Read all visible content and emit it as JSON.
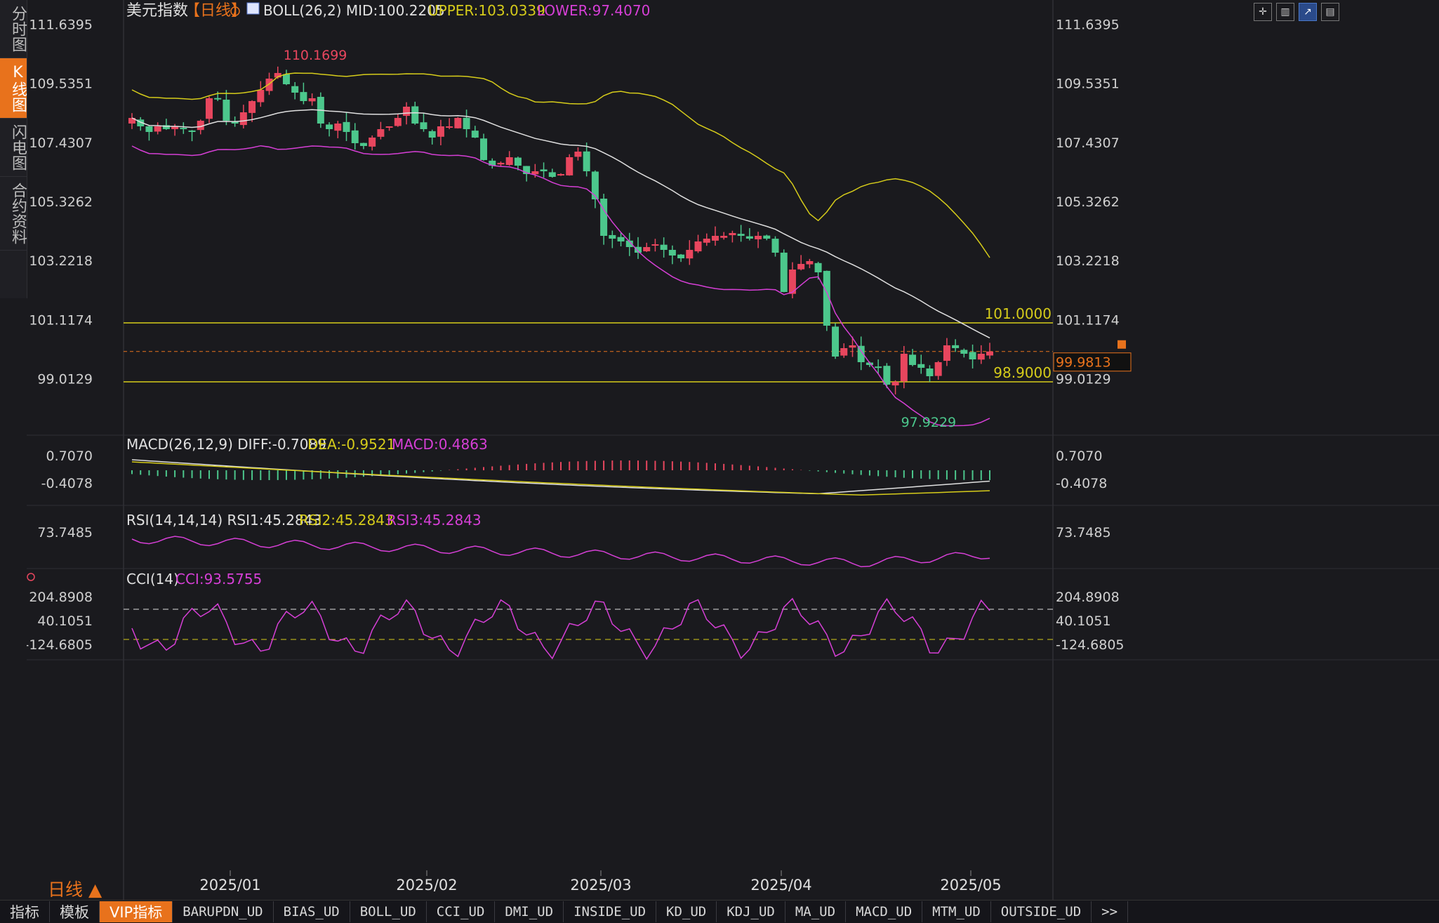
{
  "left_tabs": [
    {
      "label": "分时图",
      "active": false
    },
    {
      "label": "K线图",
      "active": true
    },
    {
      "label": "闪电图",
      "active": false
    },
    {
      "label": "合约资料",
      "active": false
    }
  ],
  "header": {
    "symbol": "美元指数",
    "period": "【日线】",
    "boll_label": "BOLL(26,2)",
    "mid": "MID:100.2205",
    "upper": "UPPER:103.0339",
    "lower": "LOWER:97.4070"
  },
  "price_axis": {
    "ticks": [
      "111.6395",
      "109.5351",
      "107.4307",
      "105.3262",
      "103.2218",
      "101.1174",
      "99.0129"
    ],
    "current_price": "99.9813",
    "high_label": "110.1699",
    "low_label": "97.9229",
    "line_labels": [
      "101.0000",
      "98.9000"
    ]
  },
  "macd": {
    "label": "MACD(26,12,9)",
    "diff": "DIFF:-0.7089",
    "dea": "DEA:-0.9521",
    "macd": "MACD:0.4863",
    "ticks": [
      "0.7070",
      "-0.4078"
    ]
  },
  "rsi": {
    "label": "RSI(14,14,14)",
    "rsi1": "RSI1:45.2843",
    "rsi2": "RSI2:45.2843",
    "rsi3": "RSI3:45.2843",
    "ticks": [
      "73.7485"
    ]
  },
  "cci": {
    "label": "CCI(14)",
    "cci": "CCI:93.5755",
    "ticks": [
      "204.8908",
      "40.1051",
      "-124.6805"
    ]
  },
  "date_axis": [
    "2025/01",
    "2025/02",
    "2025/03",
    "2025/04",
    "2025/05"
  ],
  "period_label": "日线 ▲",
  "bottom_tabs": [
    {
      "label": "指标",
      "active": false,
      "mono": false
    },
    {
      "label": "模板",
      "active": false,
      "mono": false
    },
    {
      "label": "VIP指标",
      "active": true,
      "mono": false
    },
    {
      "label": "BARUPDN_UD",
      "active": false,
      "mono": true
    },
    {
      "label": "BIAS_UD",
      "active": false,
      "mono": true
    },
    {
      "label": "BOLL_UD",
      "active": false,
      "mono": true
    },
    {
      "label": "CCI_UD",
      "active": false,
      "mono": true
    },
    {
      "label": "DMI_UD",
      "active": false,
      "mono": true
    },
    {
      "label": "INSIDE_UD",
      "active": false,
      "mono": true
    },
    {
      "label": "KD_UD",
      "active": false,
      "mono": true
    },
    {
      "label": "KDJ_UD",
      "active": false,
      "mono": true
    },
    {
      "label": "MA_UD",
      "active": false,
      "mono": true
    },
    {
      "label": "MACD_UD",
      "active": false,
      "mono": true
    },
    {
      "label": "MTM_UD",
      "active": false,
      "mono": true
    },
    {
      "label": "OUTSIDE_UD",
      "active": false,
      "mono": true
    },
    {
      "label": ">>",
      "active": false,
      "mono": true
    }
  ],
  "colors": {
    "up": "#e8465e",
    "down": "#4cc78c",
    "mid": "#e0e0e0",
    "upper": "#d6cc1a",
    "lower": "#d63fd6",
    "accent": "#e8721c",
    "hline": "#d6cc1a"
  },
  "chart_data": {
    "type": "candlestick",
    "dates_axis": [
      "2025/01",
      "2025/02",
      "2025/03",
      "2025/04",
      "2025/05"
    ],
    "y_range": [
      97.0,
      112.0
    ],
    "horizontal_lines": [
      101.0,
      98.9
    ],
    "current_price": 99.9813,
    "closes": [
      108.3,
      108.0,
      107.8,
      108.0,
      107.9,
      108.0,
      107.9,
      107.8,
      108.2,
      109.0,
      109.0,
      108.2,
      108.1,
      108.5,
      108.9,
      109.3,
      109.7,
      109.9,
      109.5,
      109.2,
      108.9,
      109.0,
      108.1,
      107.9,
      108.1,
      107.8,
      107.4,
      107.3,
      107.6,
      107.9,
      108.0,
      108.3,
      108.7,
      108.1,
      107.9,
      107.6,
      108.0,
      108.0,
      108.3,
      107.9,
      107.6,
      106.8,
      106.6,
      106.7,
      106.9,
      106.6,
      106.3,
      106.4,
      106.4,
      106.2,
      106.3,
      106.9,
      107.1,
      106.4,
      105.4,
      104.1,
      104.0,
      103.9,
      103.7,
      103.5,
      103.7,
      103.8,
      103.6,
      103.4,
      103.3,
      103.6,
      103.9,
      104.0,
      104.1,
      104.1,
      104.2,
      104.1,
      104.0,
      104.1,
      104.0,
      103.5,
      102.1,
      102.9,
      103.1,
      103.2,
      102.8,
      100.9,
      99.8,
      100.1,
      100.2,
      99.6,
      99.5,
      99.4,
      98.8,
      98.9,
      99.9,
      99.5,
      99.4,
      99.1,
      99.6,
      100.2,
      100.1,
      99.9,
      99.7,
      99.9,
      99.98
    ]
  }
}
